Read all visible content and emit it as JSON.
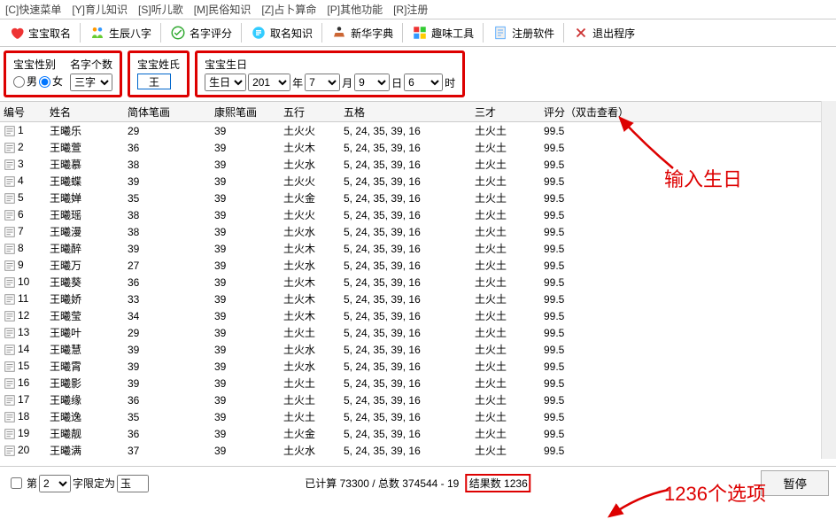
{
  "menubar": [
    "[C]快速菜单",
    "[Y]育儿知识",
    "[S]听儿歌",
    "[M]民俗知识",
    "[Z]占卜算命",
    "[P]其他功能",
    "[R]注册"
  ],
  "toolbar": [
    {
      "label": "宝宝取名"
    },
    {
      "label": "生辰八字"
    },
    {
      "label": "名字评分"
    },
    {
      "label": "取名知识"
    },
    {
      "label": "新华字典"
    },
    {
      "label": "趣味工具"
    },
    {
      "label": "注册软件"
    },
    {
      "label": "退出程序"
    }
  ],
  "gender_panel": {
    "title": "宝宝性别",
    "male": "男",
    "female": "女"
  },
  "count_panel": {
    "title": "名字个数",
    "value": "三字"
  },
  "surname_panel": {
    "title": "宝宝姓氏",
    "value": "王"
  },
  "birthday_panel": {
    "title": "宝宝生日",
    "date_sel": "生日",
    "year": "201",
    "y": "年",
    "month": "7",
    "m": "月",
    "day": "9",
    "d": "日",
    "hour": "6",
    "h": "时"
  },
  "columns": [
    "编号",
    "姓名",
    "简体笔画",
    "康熙笔画",
    "五行",
    "五格",
    "三才",
    "评分（双击查看）"
  ],
  "rows": [
    {
      "n": "1",
      "name": "王曦乐",
      "s": "29",
      "k": "39",
      "wx": "土火火",
      "wg": "5, 24, 35, 39, 16",
      "sc": "土火土",
      "score": "99.5"
    },
    {
      "n": "2",
      "name": "王曦萱",
      "s": "36",
      "k": "39",
      "wx": "土火木",
      "wg": "5, 24, 35, 39, 16",
      "sc": "土火土",
      "score": "99.5"
    },
    {
      "n": "3",
      "name": "王曦慕",
      "s": "38",
      "k": "39",
      "wx": "土火水",
      "wg": "5, 24, 35, 39, 16",
      "sc": "土火土",
      "score": "99.5"
    },
    {
      "n": "4",
      "name": "王曦蝶",
      "s": "39",
      "k": "39",
      "wx": "土火火",
      "wg": "5, 24, 35, 39, 16",
      "sc": "土火土",
      "score": "99.5"
    },
    {
      "n": "5",
      "name": "王曦婵",
      "s": "35",
      "k": "39",
      "wx": "土火金",
      "wg": "5, 24, 35, 39, 16",
      "sc": "土火土",
      "score": "99.5"
    },
    {
      "n": "6",
      "name": "王曦瑶",
      "s": "38",
      "k": "39",
      "wx": "土火火",
      "wg": "5, 24, 35, 39, 16",
      "sc": "土火土",
      "score": "99.5"
    },
    {
      "n": "7",
      "name": "王曦漫",
      "s": "38",
      "k": "39",
      "wx": "土火水",
      "wg": "5, 24, 35, 39, 16",
      "sc": "土火土",
      "score": "99.5"
    },
    {
      "n": "8",
      "name": "王曦醉",
      "s": "39",
      "k": "39",
      "wx": "土火木",
      "wg": "5, 24, 35, 39, 16",
      "sc": "土火土",
      "score": "99.5"
    },
    {
      "n": "9",
      "name": "王曦万",
      "s": "27",
      "k": "39",
      "wx": "土火水",
      "wg": "5, 24, 35, 39, 16",
      "sc": "土火土",
      "score": "99.5"
    },
    {
      "n": "10",
      "name": "王曦葵",
      "s": "36",
      "k": "39",
      "wx": "土火木",
      "wg": "5, 24, 35, 39, 16",
      "sc": "土火土",
      "score": "99.5"
    },
    {
      "n": "11",
      "name": "王曦娇",
      "s": "33",
      "k": "39",
      "wx": "土火木",
      "wg": "5, 24, 35, 39, 16",
      "sc": "土火土",
      "score": "99.5"
    },
    {
      "n": "12",
      "name": "王曦莹",
      "s": "34",
      "k": "39",
      "wx": "土火木",
      "wg": "5, 24, 35, 39, 16",
      "sc": "土火土",
      "score": "99.5"
    },
    {
      "n": "13",
      "name": "王曦叶",
      "s": "29",
      "k": "39",
      "wx": "土火土",
      "wg": "5, 24, 35, 39, 16",
      "sc": "土火土",
      "score": "99.5"
    },
    {
      "n": "14",
      "name": "王曦慧",
      "s": "39",
      "k": "39",
      "wx": "土火水",
      "wg": "5, 24, 35, 39, 16",
      "sc": "土火土",
      "score": "99.5"
    },
    {
      "n": "15",
      "name": "王曦霄",
      "s": "39",
      "k": "39",
      "wx": "土火水",
      "wg": "5, 24, 35, 39, 16",
      "sc": "土火土",
      "score": "99.5"
    },
    {
      "n": "16",
      "name": "王曦影",
      "s": "39",
      "k": "39",
      "wx": "土火土",
      "wg": "5, 24, 35, 39, 16",
      "sc": "土火土",
      "score": "99.5"
    },
    {
      "n": "17",
      "name": "王曦缘",
      "s": "36",
      "k": "39",
      "wx": "土火土",
      "wg": "5, 24, 35, 39, 16",
      "sc": "土火土",
      "score": "99.5"
    },
    {
      "n": "18",
      "name": "王曦逸",
      "s": "35",
      "k": "39",
      "wx": "土火土",
      "wg": "5, 24, 35, 39, 16",
      "sc": "土火土",
      "score": "99.5"
    },
    {
      "n": "19",
      "name": "王曦靓",
      "s": "36",
      "k": "39",
      "wx": "土火金",
      "wg": "5, 24, 35, 39, 16",
      "sc": "土火土",
      "score": "99.5"
    },
    {
      "n": "20",
      "name": "王曦满",
      "s": "37",
      "k": "39",
      "wx": "土火水",
      "wg": "5, 24, 35, 39, 16",
      "sc": "土火土",
      "score": "99.5"
    }
  ],
  "bottom": {
    "checkbox_label": "第",
    "page": "2",
    "limit_label": "字限定为",
    "limit_value": "玉",
    "status_prefix": "已计算 73300 / 总数 374544 - 19",
    "result_label": "结果数 1236",
    "pause": "暂停"
  },
  "annotations": {
    "birthday": "输入生日",
    "options": "1236个选项"
  }
}
